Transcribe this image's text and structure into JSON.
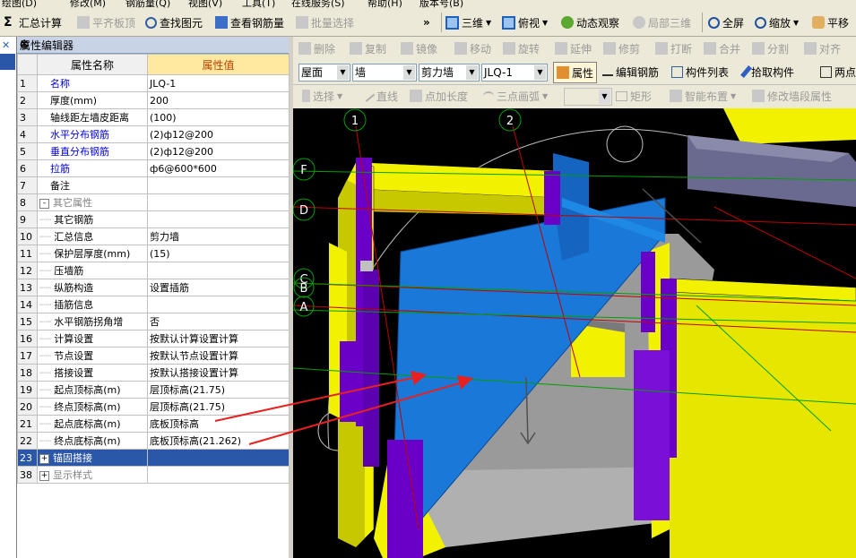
{
  "menubar": {
    "items": [
      "绘图(D)",
      "修改(M)",
      "钢筋量(Q)",
      "视图(V)",
      "工具(T)",
      "在线服务(S)",
      "帮助(H)",
      "版本号(B)"
    ]
  },
  "toolbar": {
    "summary_calc": "汇总计算",
    "flatten_top": "平齐板顶",
    "find_element": "查找图元",
    "view_rebar": "查看钢筋量",
    "batch_select": "批量选择",
    "more": "»",
    "view_3d": "三维",
    "top_view": "俯视",
    "dynamic_observe": "动态观察",
    "local_3d": "局部三维",
    "fullscreen": "全屏",
    "zoom": "缩放",
    "pan": "平移"
  },
  "property_editor": {
    "title": "属性编辑器",
    "pin": "ф",
    "close": "✕",
    "col_name": "属性名称",
    "col_value": "属性值",
    "rows": [
      {
        "num": "1",
        "name": "名称",
        "value": "JLQ-1",
        "style": "blue"
      },
      {
        "num": "2",
        "name": "厚度(mm)",
        "value": "200",
        "style": ""
      },
      {
        "num": "3",
        "name": "轴线距左墙皮距离",
        "value": "(100)",
        "style": ""
      },
      {
        "num": "4",
        "name": "水平分布钢筋",
        "value": "(2)ф12@200",
        "style": "blue"
      },
      {
        "num": "5",
        "name": "垂直分布钢筋",
        "value": "(2)ф12@200",
        "style": "blue"
      },
      {
        "num": "6",
        "name": "拉筋",
        "value": "ф6@600*600",
        "style": "blue"
      },
      {
        "num": "7",
        "name": "备注",
        "value": "",
        "style": ""
      },
      {
        "num": "8",
        "name": "其它属性",
        "value": "",
        "style": "grey",
        "group": "-"
      },
      {
        "num": "9",
        "name": "其它钢筋",
        "value": "",
        "style": "",
        "indent": true
      },
      {
        "num": "10",
        "name": "汇总信息",
        "value": "剪力墙",
        "style": "",
        "indent": true
      },
      {
        "num": "11",
        "name": "保护层厚度(mm)",
        "value": "(15)",
        "style": "",
        "indent": true
      },
      {
        "num": "12",
        "name": "压墙筋",
        "value": "",
        "style": "",
        "indent": true
      },
      {
        "num": "13",
        "name": "纵筋构造",
        "value": "设置插筋",
        "style": "",
        "indent": true
      },
      {
        "num": "14",
        "name": "插筋信息",
        "value": "",
        "style": "",
        "indent": true
      },
      {
        "num": "15",
        "name": "水平钢筋拐角增",
        "value": "否",
        "style": "",
        "indent": true
      },
      {
        "num": "16",
        "name": "计算设置",
        "value": "按默认计算设置计算",
        "style": "",
        "indent": true
      },
      {
        "num": "17",
        "name": "节点设置",
        "value": "按默认节点设置计算",
        "style": "",
        "indent": true
      },
      {
        "num": "18",
        "name": "搭接设置",
        "value": "按默认搭接设置计算",
        "style": "",
        "indent": true
      },
      {
        "num": "19",
        "name": "起点顶标高(m)",
        "value": "层顶标高(21.75)",
        "style": "",
        "indent": true
      },
      {
        "num": "20",
        "name": "终点顶标高(m)",
        "value": "层顶标高(21.75)",
        "style": "",
        "indent": true
      },
      {
        "num": "21",
        "name": "起点底标高(m)",
        "value": "底板顶标高",
        "style": "",
        "indent": true
      },
      {
        "num": "22",
        "name": "终点底标高(m)",
        "value": "底板顶标高(21.262)",
        "style": "",
        "indent": true
      },
      {
        "num": "23",
        "name": "锚固搭接",
        "value": "",
        "style": "sel",
        "group": "+"
      },
      {
        "num": "38",
        "name": "显示样式",
        "value": "",
        "style": "grey",
        "group": "+"
      }
    ]
  },
  "edit_toolbar": {
    "delete": "删除",
    "copy": "复制",
    "mirror": "镜像",
    "move": "移动",
    "rotate": "旋转",
    "extend": "延伸",
    "trim": "修剪",
    "break": "打断",
    "merge": "合并",
    "split": "分割",
    "align": "对齐"
  },
  "layer_toolbar": {
    "floor": "屋面",
    "type": "墙",
    "subtype": "剪力墙",
    "element": "JLQ-1",
    "attribute": "属性",
    "edit_rebar": "编辑钢筋",
    "element_list": "构件列表",
    "pick_element": "拾取构件",
    "two_point": "两点"
  },
  "draw_toolbar": {
    "select": "选择",
    "line": "直线",
    "point_length": "点加长度",
    "three_point_arc": "三点画弧",
    "rect": "矩形",
    "smart_layout": "智能布置",
    "modify_wall_segment": "修改墙段属性"
  },
  "viewport": {
    "axis_labels": [
      "1",
      "2",
      "F",
      "D",
      "C",
      "B",
      "A"
    ],
    "colors": {
      "bg": "#000000",
      "wall_top": "#f2f200",
      "wall_face": "#c8c800",
      "column": "#6a00c8",
      "selected_wall": "#1a78d8",
      "floor": "#9a9a9a",
      "arrow": "#e82020",
      "grid_red": "#c00000",
      "grid_green": "#00a000",
      "grey_block": "#707090"
    }
  }
}
